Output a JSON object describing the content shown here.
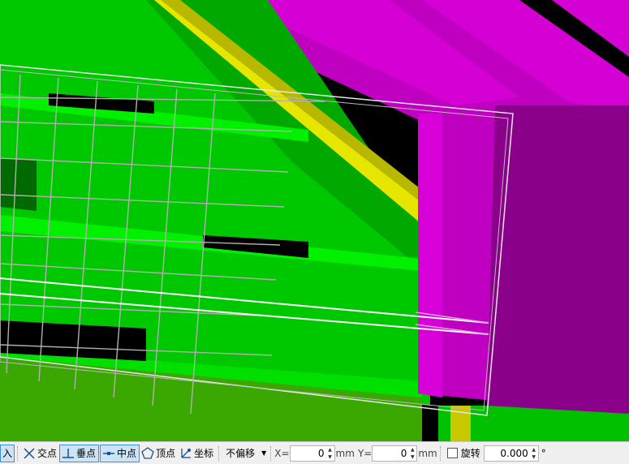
{
  "statusbar": {
    "cut_label": "入",
    "snap": {
      "intersection": "交点",
      "perpendicular": "垂点",
      "midpoint": "中点",
      "vertex": "顶点",
      "coordinate": "坐标"
    },
    "offset_mode": "不偏移",
    "x_label": "X=",
    "x_value": "0",
    "x_unit": "mm",
    "y_label": "Y=",
    "y_value": "0",
    "y_unit": "mm",
    "rotate_label": "旋转",
    "rotate_value": "0.000",
    "rotate_unit": "°"
  },
  "colors": {
    "green_bright": "#00dd00",
    "green_mid": "#00b400",
    "green_dark": "#008a00",
    "magenta": "#cc00cc",
    "magenta_dark": "#8a008a",
    "yellow": "#e6e600",
    "status_bg": "#f0f0f0",
    "snap_active_bg": "#cce4f7"
  },
  "icons": [
    "intersection-snap-icon",
    "perpendicular-snap-icon",
    "midpoint-snap-icon",
    "vertex-snap-icon",
    "coordinate-snap-icon"
  ]
}
